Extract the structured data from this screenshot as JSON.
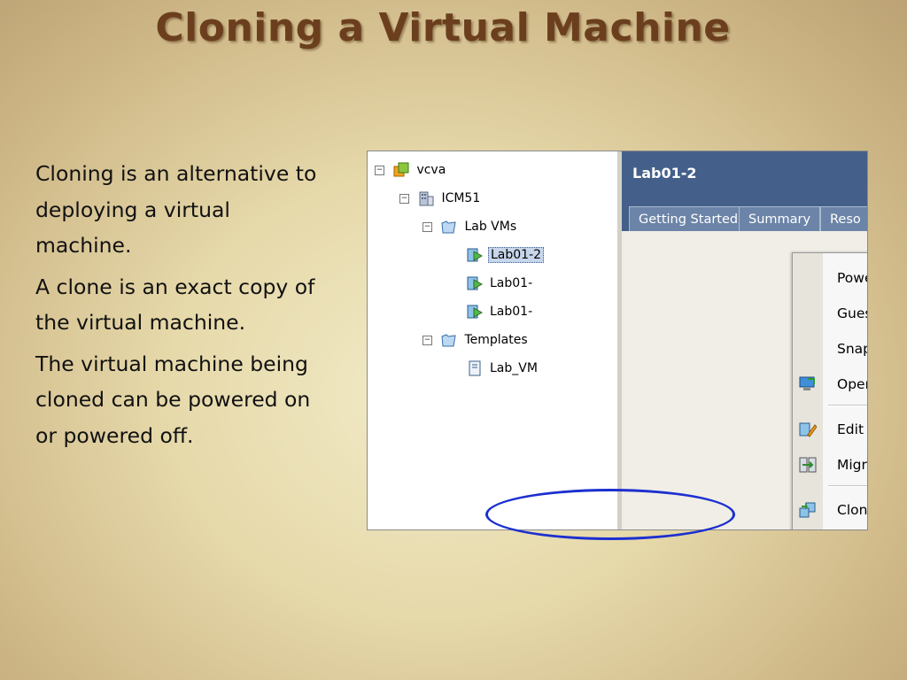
{
  "slide": {
    "title": "Cloning a Virtual Machine",
    "bullets": [
      "Cloning is an alternative to deploying a virtual machine.",
      "A clone is an exact copy of the virtual machine.",
      "The virtual machine being cloned can be powered on or powered off."
    ]
  },
  "inventory": {
    "nodes": [
      {
        "label": "vcva",
        "icon": "vcenter-icon",
        "toggle": "−"
      },
      {
        "label": "ICM51",
        "icon": "datacenter-icon",
        "toggle": "−"
      },
      {
        "label": "Lab VMs",
        "icon": "folder-icon",
        "toggle": "−"
      },
      {
        "label": "Lab01-2",
        "icon": "vm-icon",
        "selected": true
      },
      {
        "label": "Lab01-",
        "icon": "vm-icon"
      },
      {
        "label": "Lab01-",
        "icon": "vm-icon"
      },
      {
        "label": "Templates",
        "icon": "folder-icon",
        "toggle": "−"
      },
      {
        "label": "Lab_VM",
        "icon": "template-icon"
      }
    ]
  },
  "detail": {
    "vm_name": "Lab01-2",
    "tabs": [
      "Getting Started",
      "Summary",
      "Reso"
    ]
  },
  "context_menu": {
    "items": [
      {
        "label": "Power",
        "submenu": true
      },
      {
        "label": "Guest",
        "submenu": true
      },
      {
        "label": "Snapshot",
        "submenu": true
      },
      {
        "label": "Open Console",
        "icon": "console-icon"
      },
      {
        "label": "Edit Settings...",
        "icon": "edit-settings-icon"
      },
      {
        "label": "Migrate...",
        "icon": "migrate-icon"
      },
      {
        "label": "Clone...",
        "icon": "clone-icon"
      }
    ],
    "arrow_glyph": "▶"
  },
  "colors": {
    "title": "#6b3f1e",
    "highlight_circle": "#1c2fd0",
    "vm_header": "#44608a"
  }
}
